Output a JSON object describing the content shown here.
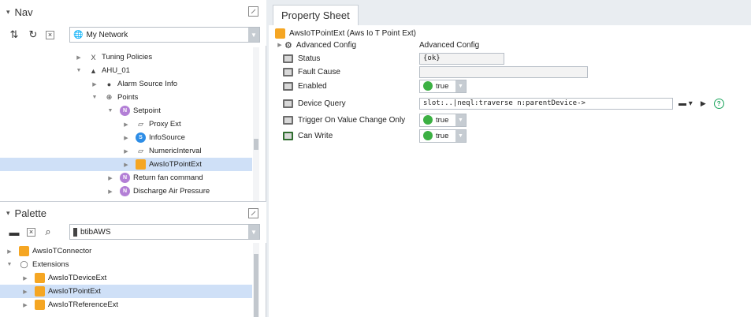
{
  "nav": {
    "title": "Nav",
    "station": "My Network",
    "tree": [
      {
        "label": "Tuning Policies",
        "indent": 1
      },
      {
        "label": "AHU_01",
        "indent": 1
      },
      {
        "label": "Alarm Source Info",
        "indent": 2
      },
      {
        "label": "Points",
        "indent": 2
      },
      {
        "label": "Setpoint",
        "indent": 3
      },
      {
        "label": "Proxy Ext",
        "indent": 4
      },
      {
        "label": "InfoSource",
        "indent": 4
      },
      {
        "label": "NumericInterval",
        "indent": 4
      },
      {
        "label": "AwsIoTPointExt",
        "indent": 4,
        "selected": true
      },
      {
        "label": "Return fan command",
        "indent": 3
      },
      {
        "label": "Discharge Air Pressure",
        "indent": 3
      }
    ]
  },
  "palette": {
    "title": "Palette",
    "module": "btibAWS",
    "tree": [
      {
        "label": "AwsIoTConnector",
        "indent": 0
      },
      {
        "label": "Extensions",
        "indent": 0
      },
      {
        "label": "AwsIoTDeviceExt",
        "indent": 1
      },
      {
        "label": "AwsIoTPointExt",
        "indent": 1,
        "selected": true
      },
      {
        "label": "AwsIoTReferenceExt",
        "indent": 1
      }
    ]
  },
  "property_sheet": {
    "tab": "Property Sheet",
    "header": "AwsIoTPointExt  (Aws Io T Point Ext)",
    "rows": {
      "advanced_name": "Advanced Config",
      "advanced_value": "Advanced Config",
      "status_name": "Status",
      "status_value": "{ok}",
      "fault_name": "Fault Cause",
      "fault_value": "",
      "enabled_name": "Enabled",
      "enabled_value": "true",
      "query_name": "Device Query",
      "query_value": "slot:..|neql:traverse n:parentDevice->",
      "trigger_name": "Trigger On Value Change Only",
      "trigger_value": "true",
      "canwrite_name": "Can Write",
      "canwrite_value": "true"
    }
  }
}
